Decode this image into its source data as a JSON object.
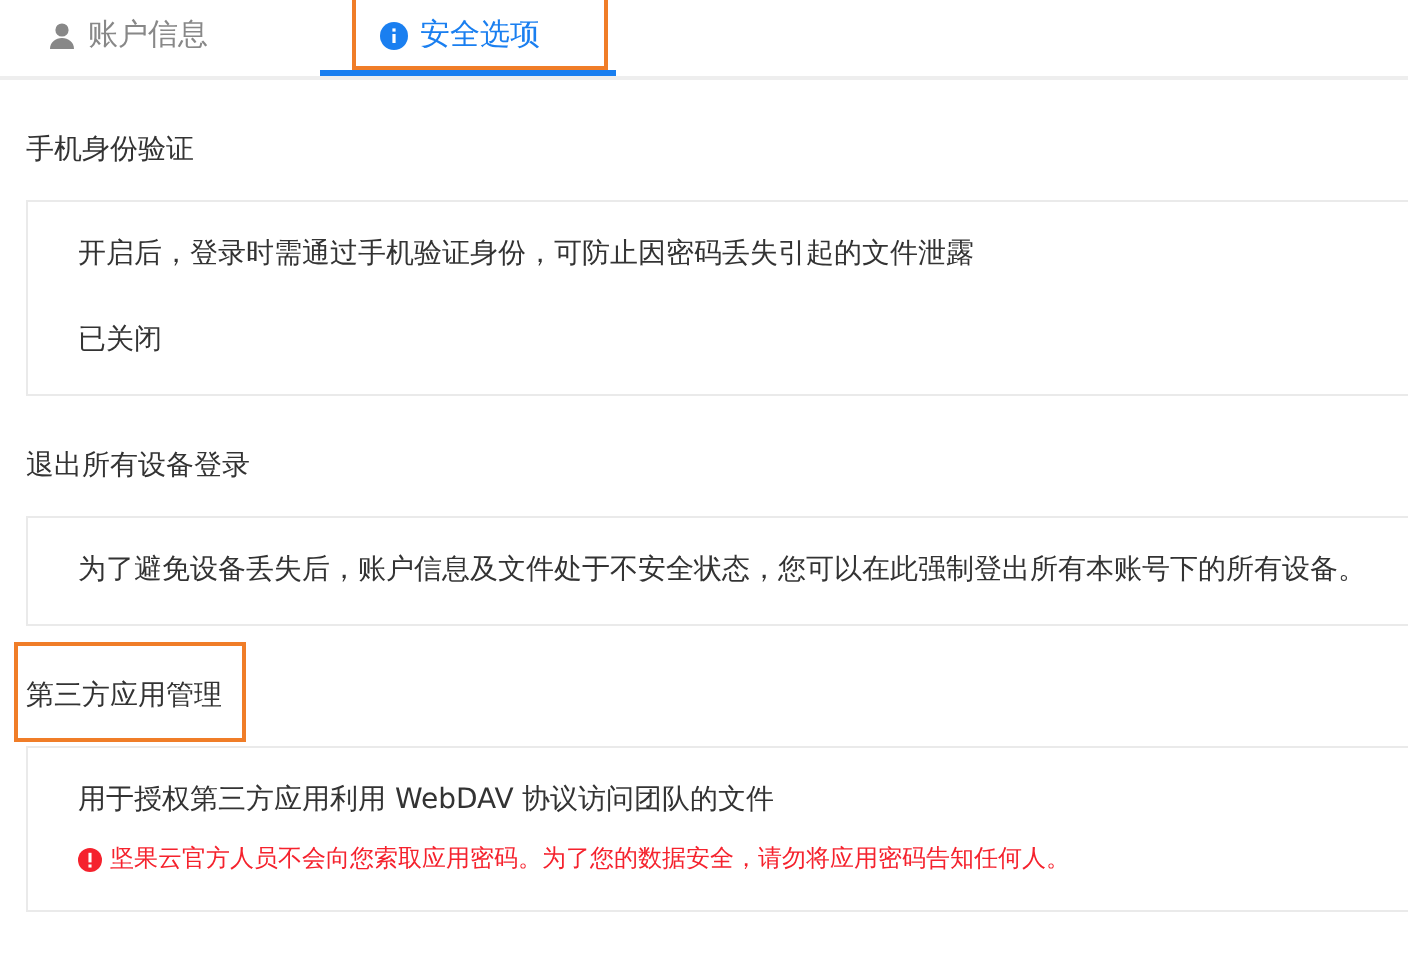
{
  "tabs": [
    {
      "label": "账户信息",
      "kind": "person",
      "selected": false,
      "highlighted": false
    },
    {
      "label": "安全选项",
      "kind": "info",
      "selected": true,
      "highlighted": true
    }
  ],
  "sections": [
    {
      "title": "手机身份验证",
      "highlighted": false,
      "lines": [
        {
          "kind": "text",
          "text": "开启后，登录时需通过手机验证身份，可防止因密码丢失引起的文件泄露"
        },
        {
          "kind": "text",
          "text": "已关闭"
        }
      ]
    },
    {
      "title": "退出所有设备登录",
      "highlighted": false,
      "lines": [
        {
          "kind": "text",
          "text": "为了避免设备丢失后，账户信息及文件处于不安全状态，您可以在此强制登出所有本账号下的所有设备。"
        }
      ]
    },
    {
      "title": "第三方应用管理",
      "highlighted": true,
      "lines": [
        {
          "kind": "text",
          "text": "用于授权第三方应用利用 WebDAV 协议访问团队的文件"
        },
        {
          "kind": "warning",
          "text": "坚果云官方人员不会向您索取应用密码。为了您的数据安全，请勿将应用密码告知任何人。"
        }
      ]
    }
  ]
}
